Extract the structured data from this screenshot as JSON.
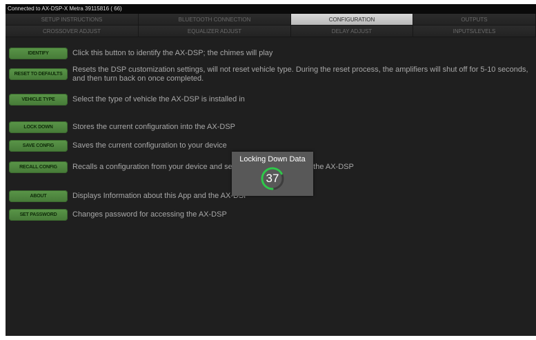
{
  "status_bar": {
    "text": "Connected to AX-DSP-X Metra 39115816 ( 66)"
  },
  "tabs_row1": [
    {
      "label": "SETUP INSTRUCTIONS",
      "active": false
    },
    {
      "label": "BLUETOOTH CONNECTION",
      "active": false
    },
    {
      "label": "CONFIGURATION",
      "active": true
    },
    {
      "label": "OUTPUTS",
      "active": false
    }
  ],
  "tabs_row2": [
    {
      "label": "CROSSOVER ADJUST",
      "active": false
    },
    {
      "label": "EQUALIZER ADJUST",
      "active": false
    },
    {
      "label": "DELAY ADJUST",
      "active": false
    },
    {
      "label": "INPUTS/LEVELS",
      "active": false
    }
  ],
  "config_items": [
    {
      "button": "IDENTIFY",
      "desc": "Click this button to identify the AX-DSP; the chimes will play"
    },
    {
      "button": "RESET TO DEFAULTS",
      "desc": "Resets the DSP customization settings, will not reset vehicle type. During the reset process, the amplifiers will shut off for 5-10 seconds, and then turn back on once completed."
    },
    {
      "button": "VEHICLE TYPE",
      "desc": "Select the type of vehicle the AX-DSP is installed in"
    },
    {
      "button": "LOCK DOWN",
      "desc": "Stores the current configuration into the AX-DSP"
    },
    {
      "button": "SAVE CONFIG",
      "desc": "Saves the current configuration to your device"
    },
    {
      "button": "RECALL CONFIG",
      "desc": "Recalls a configuration from your device and sends the configuration to the AX-DSP"
    },
    {
      "button": "ABOUT",
      "desc": "Displays Information about this App and the AX-DSP"
    },
    {
      "button": "SET PASSWORD",
      "desc": "Changes password for accessing the AX-DSP"
    }
  ],
  "progress_dialog": {
    "title": "Locking Down Data",
    "value": "37",
    "fraction": 0.37
  },
  "colors": {
    "accent_green": "#4f8a3f",
    "spinner_green": "#2fc84a",
    "active_tab": "#cfcfcf",
    "background": "#1f1f1f"
  }
}
